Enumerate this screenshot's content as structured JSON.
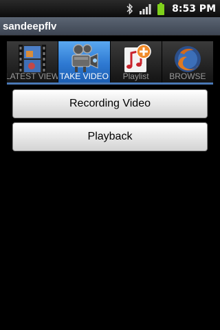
{
  "status_bar": {
    "time": "8:53 PM",
    "icons": [
      "bluetooth-icon",
      "signal-icon",
      "battery-icon"
    ]
  },
  "app": {
    "title": "sandeepflv"
  },
  "tabs": [
    {
      "label": "LATEST VIEW",
      "icon": "film-strip-icon",
      "active": false
    },
    {
      "label": "TAKE VIDEO",
      "icon": "video-camera-icon",
      "active": true
    },
    {
      "label": "Playlist",
      "icon": "music-note-add-icon",
      "active": false
    },
    {
      "label": "BROWSE",
      "icon": "firefox-globe-icon",
      "active": false
    }
  ],
  "buttons": {
    "recording_label": "Recording Video",
    "playback_label": "Playback"
  },
  "colors": {
    "active_tab": "#2e79d2",
    "title_bar": "#4a5360",
    "battery": "#7fd11b"
  }
}
